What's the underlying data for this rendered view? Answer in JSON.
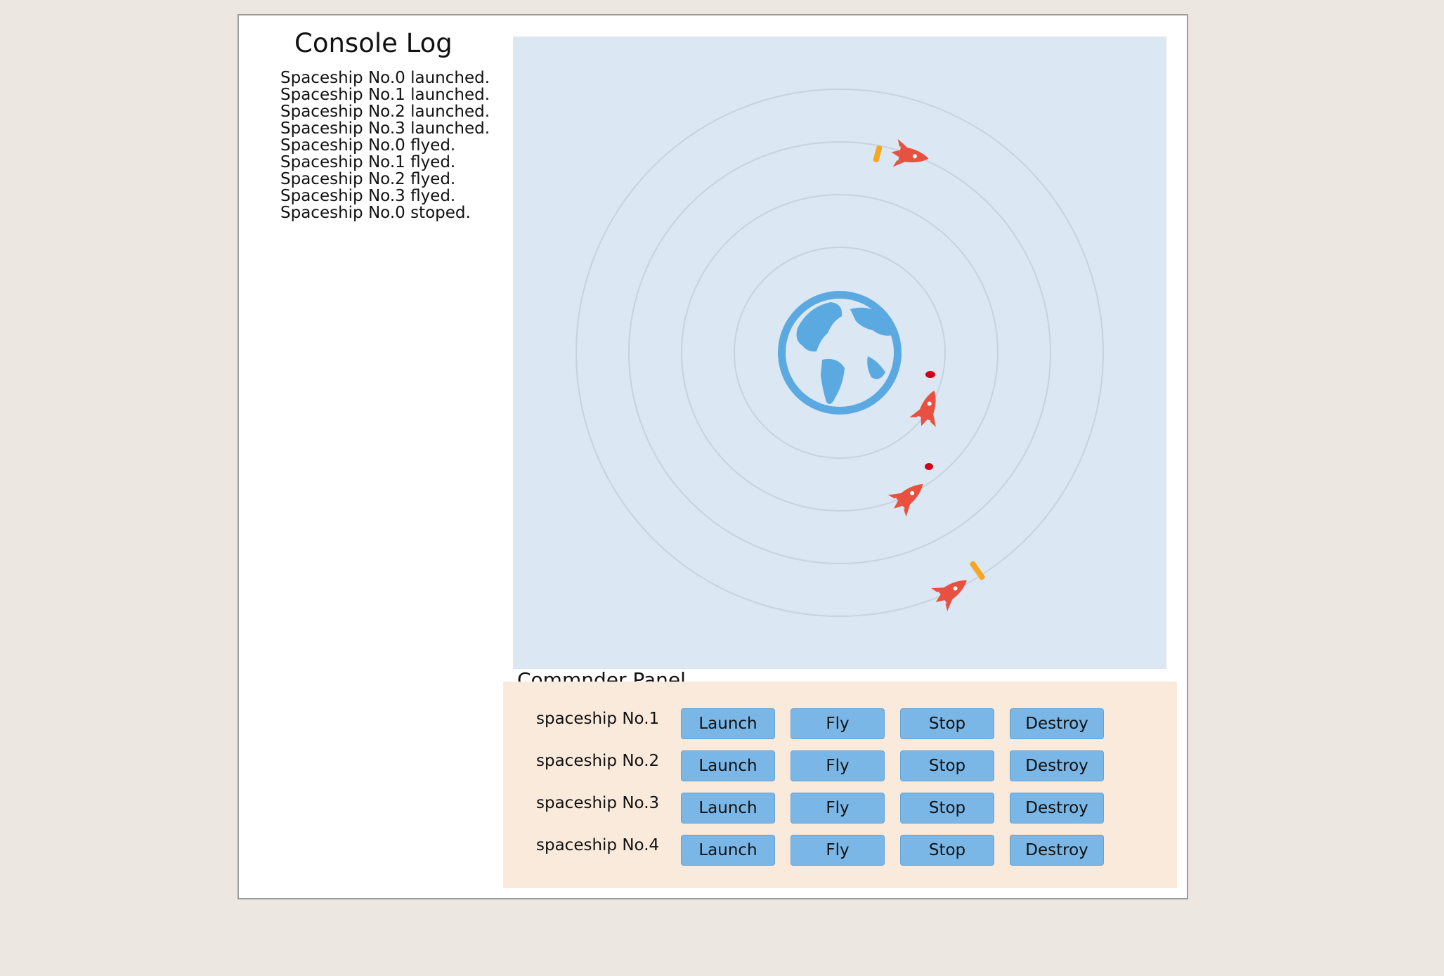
{
  "console": {
    "title": "Console Log",
    "lines": [
      "Spaceship No.0 launched.",
      "Spaceship No.1 launched.",
      "Spaceship No.2 launched.",
      "Spaceship No.3 launched.",
      "Spaceship No.0 flyed.",
      "Spaceship No.1 flyed.",
      "Spaceship No.2 flyed.",
      "Spaceship No.3 flyed.",
      "Spaceship No.0 stoped."
    ]
  },
  "space": {
    "background": "#dbe7f2",
    "orbit_color": "#c7d3dc",
    "planet_color": "#5aa9e0",
    "ship_color": "#e8503f",
    "energy_colors": [
      "#f5a623",
      "#d0021b",
      "#d0021b",
      "#f5a623"
    ]
  },
  "commander": {
    "title": "Commnder Panel",
    "ships": [
      {
        "label": "spaceship No.1",
        "buttons": [
          "Launch",
          "Fly",
          "Stop",
          "Destroy"
        ]
      },
      {
        "label": "spaceship No.2",
        "buttons": [
          "Launch",
          "Fly",
          "Stop",
          "Destroy"
        ]
      },
      {
        "label": "spaceship No.3",
        "buttons": [
          "Launch",
          "Fly",
          "Stop",
          "Destroy"
        ]
      },
      {
        "label": "spaceship No.4",
        "buttons": [
          "Launch",
          "Fly",
          "Stop",
          "Destroy"
        ]
      }
    ]
  }
}
